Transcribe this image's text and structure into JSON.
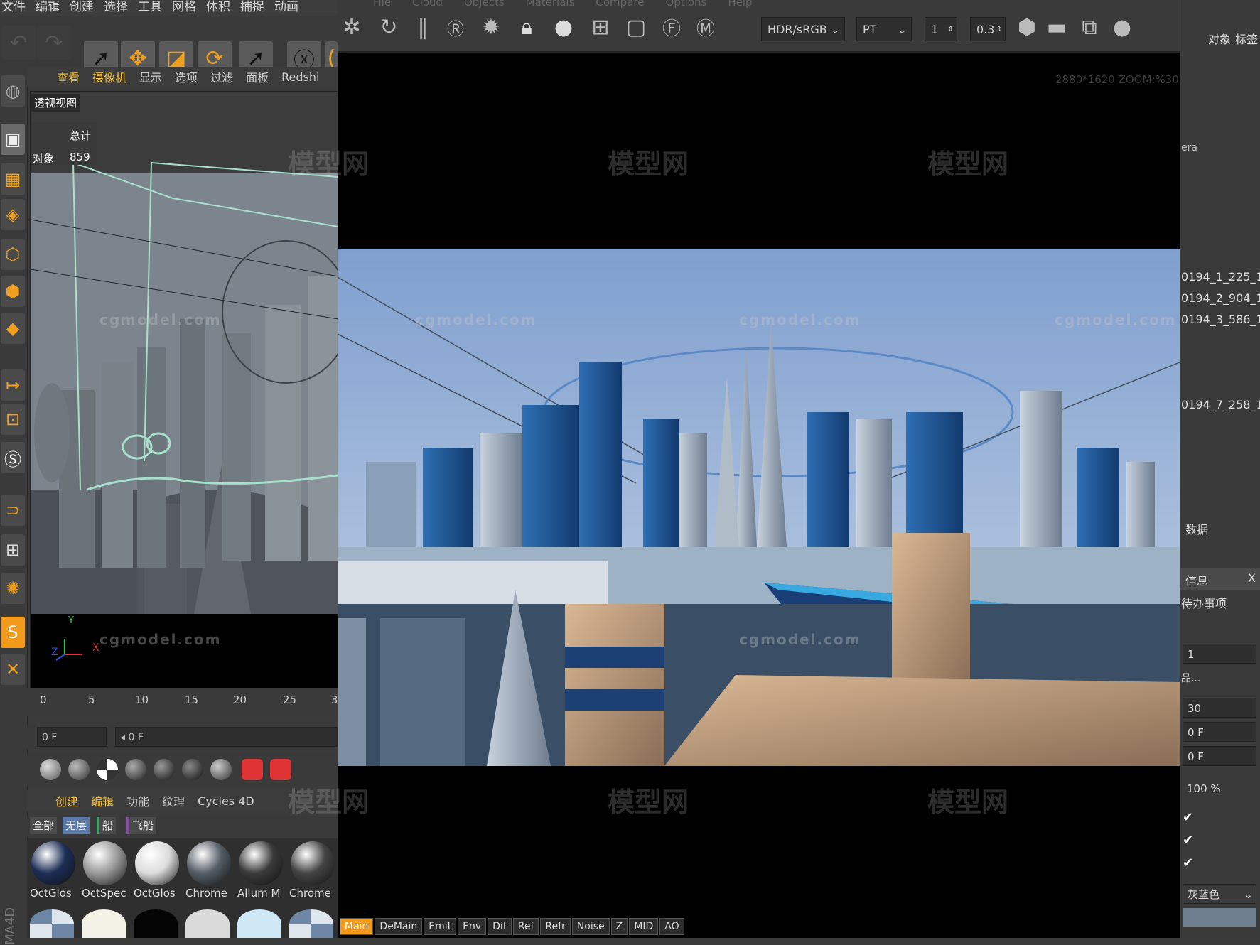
{
  "c4d": {
    "menu": [
      "文件",
      "编辑",
      "创建",
      "选择",
      "工具",
      "网格",
      "体积",
      "捕捉",
      "动画"
    ],
    "viewport_menu": [
      "查看",
      "摄像机",
      "显示",
      "选项",
      "过滤",
      "面板",
      "Redshi"
    ],
    "viewport_title": "透视视图",
    "hud": {
      "total_label": "总计",
      "objects_label": "对象",
      "objects_value": "859"
    },
    "axis": {
      "x": "X",
      "y": "Y",
      "z": "Z"
    },
    "timeline_ticks": [
      "0",
      "5",
      "10",
      "15",
      "20",
      "25",
      "3"
    ],
    "frame_current": "0 F",
    "frame_slider": "◂ 0 F",
    "material_menu": [
      "创建",
      "编辑",
      "功能",
      "纹理",
      "Cycles 4D"
    ],
    "material_filters": [
      "全部",
      "无层",
      "船",
      "飞船"
    ],
    "materials": [
      {
        "name": "OctGlos",
        "color": "#1c2d55"
      },
      {
        "name": "OctSpec",
        "color": "#9a9a9a"
      },
      {
        "name": "OctGlos",
        "color": "#dcdcdc"
      },
      {
        "name": "Chrome",
        "color": "#555d66"
      },
      {
        "name": "Allum M",
        "color": "#3a3a3a"
      },
      {
        "name": "Chrome",
        "color": "#444444"
      }
    ],
    "brand_vertical": "MA4D"
  },
  "octane": {
    "menu_faint": [
      "File",
      "Cloud",
      "Objects",
      "Materials",
      "Compare",
      "Options",
      "Help"
    ],
    "color_space": "HDR/sRGB",
    "kernel": "PT",
    "value1": "1",
    "value2": "0.3",
    "resolution_label": "2880*1620 ZOOM:%30",
    "pass_tabs": [
      "Main",
      "DeMain",
      "Emit",
      "Env",
      "Dif",
      "Ref",
      "Refr",
      "Noise",
      "Z",
      "MID",
      "AO"
    ]
  },
  "right_panel": {
    "tabs": [
      "对象",
      "标签"
    ],
    "partial_label": "era",
    "items": [
      "0194_1_225_1",
      "0194_2_904_1",
      "0194_3_586_1",
      "0194_7_258_1"
    ],
    "section_data": "数据",
    "info_tab": "信息",
    "info_x": "X",
    "todo_tab": "待办事项",
    "field1": "1",
    "partial_label2": "品...",
    "fps": "30",
    "frame_a": "0 F",
    "frame_b": "0 F",
    "zoom": "100 %",
    "checks": [
      "✔",
      "✔",
      "✔"
    ],
    "color_select": "灰蓝色"
  },
  "watermark": {
    "site": "cgmodel.com",
    "brand": "模型网"
  },
  "colors": {
    "accent_orange": "#f29a1c",
    "octane_selected_tab": "#f29a1c",
    "bg_dark": "#3a3a3a"
  }
}
